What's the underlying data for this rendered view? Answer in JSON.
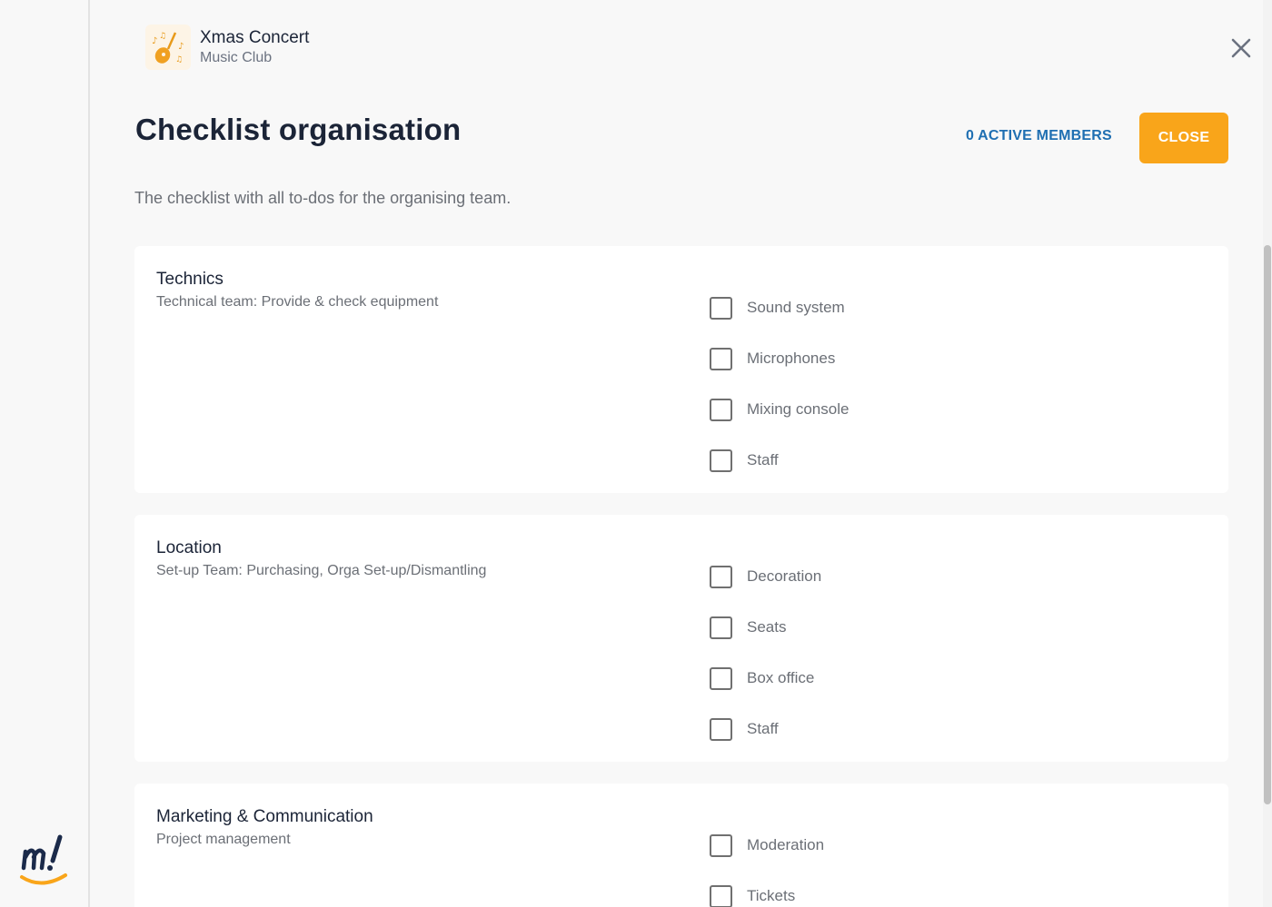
{
  "event": {
    "title": "Xmas Concert",
    "subtitle": "Music Club",
    "icon": "guitar-music-notes-icon"
  },
  "page": {
    "title": "Checklist organisation",
    "description": "The checklist with all to-dos for the organising team.",
    "active_members_label": "0 ACTIVE MEMBERS",
    "close_label": "CLOSE"
  },
  "colors": {
    "accent": "#f9a51a",
    "link": "#1f6fb2",
    "text": "#1b2437",
    "muted": "#6b6f76"
  },
  "sections": [
    {
      "title": "Technics",
      "subtitle": "Technical team: Provide & check equipment",
      "items": [
        {
          "label": "Sound system",
          "checked": false
        },
        {
          "label": "Microphones",
          "checked": false
        },
        {
          "label": "Mixing console",
          "checked": false
        },
        {
          "label": "Staff",
          "checked": false
        }
      ]
    },
    {
      "title": "Location",
      "subtitle": "Set-up Team: Purchasing, Orga Set-up/Dismantling",
      "items": [
        {
          "label": "Decoration",
          "checked": false
        },
        {
          "label": "Seats",
          "checked": false
        },
        {
          "label": "Box office",
          "checked": false
        },
        {
          "label": "Staff",
          "checked": false
        }
      ]
    },
    {
      "title": "Marketing & Communication",
      "subtitle": "Project management",
      "items": [
        {
          "label": "Moderation",
          "checked": false
        },
        {
          "label": "Tickets",
          "checked": false
        }
      ]
    }
  ]
}
